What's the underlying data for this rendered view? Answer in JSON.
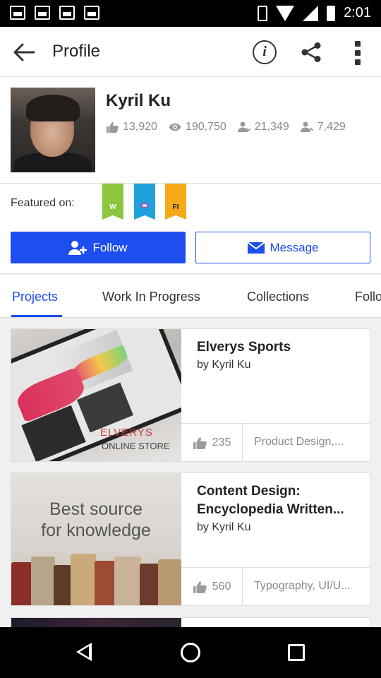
{
  "status_bar": {
    "time": "2:01"
  },
  "app_bar": {
    "title": "Profile"
  },
  "profile": {
    "name": "Kyril Ku",
    "stats": {
      "appreciations": "13,920",
      "views": "190,750",
      "followers": "21,349",
      "following": "7,429"
    }
  },
  "featured": {
    "label": "Featured on:",
    "ribbons": [
      {
        "letter": "W",
        "color": "#8dc53f"
      },
      {
        "letter": "",
        "color": "#1fa1dd"
      },
      {
        "letter": "FI",
        "color": "#f5a917"
      }
    ]
  },
  "actions": {
    "follow_label": "Follow",
    "message_label": "Message"
  },
  "tabs": [
    "Projects",
    "Work In Progress",
    "Collections",
    "Follo"
  ],
  "projects": [
    {
      "title": "Elverys Sports",
      "by": "by Kyril Ku",
      "likes": "235",
      "tags": "Product Design,...",
      "thumb_text": [
        "ELVERYS",
        "ONLINE STORE"
      ]
    },
    {
      "title": "Content Design: Encyclopedia Written...",
      "by": "by Kyril Ku",
      "likes": "560",
      "tags": "Typography, UI/U...",
      "thumb_text": [
        "Best source",
        "for knowledge"
      ]
    }
  ],
  "colors": {
    "accent": "#1c4ef0"
  }
}
